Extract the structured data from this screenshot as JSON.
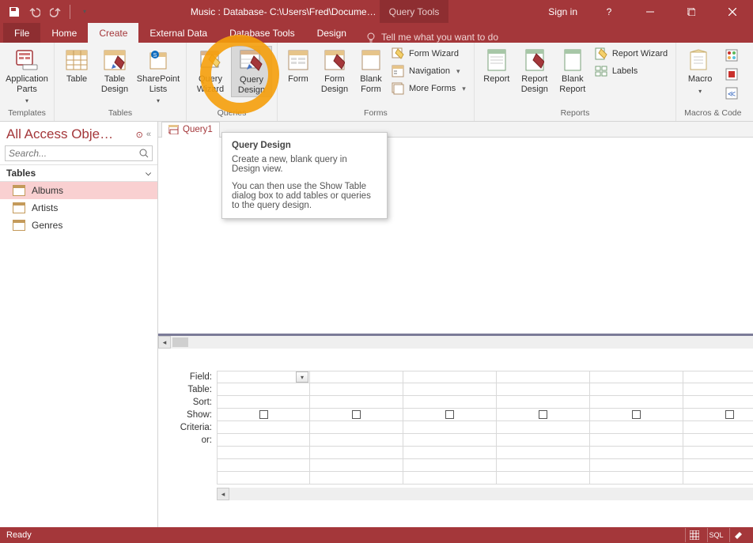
{
  "title": "Music : Database- C:\\Users\\Fred\\Docume…",
  "context_tab": "Query Tools",
  "signin": "Sign in",
  "tabs": {
    "file": "File",
    "home": "Home",
    "create": "Create",
    "external": "External Data",
    "dbtools": "Database Tools",
    "design": "Design",
    "tellme": "Tell me what you want to do"
  },
  "ribbon": {
    "templates": {
      "label": "Templates",
      "appparts": "Application\nParts"
    },
    "tables": {
      "label": "Tables",
      "table": "Table",
      "tabledesign": "Table\nDesign",
      "sharepoint": "SharePoint\nLists"
    },
    "queries": {
      "label": "Queries",
      "wizard": "Query\nWizard",
      "design": "Query\nDesign"
    },
    "forms": {
      "label": "Forms",
      "form": "Form",
      "formdesign": "Form\nDesign",
      "blank": "Blank\nForm",
      "formwiz": "Form Wizard",
      "nav": "Navigation",
      "more": "More Forms"
    },
    "reports": {
      "label": "Reports",
      "report": "Report",
      "rptdesign": "Report\nDesign",
      "blankrpt": "Blank\nReport",
      "rptwiz": "Report Wizard",
      "labels": "Labels"
    },
    "macros": {
      "label": "Macros & Code",
      "macro": "Macro"
    }
  },
  "tooltip": {
    "title": "Query Design",
    "p1": "Create a new, blank query in Design view.",
    "p2": "You can then use the Show Table dialog box to add tables or queries to the query design."
  },
  "sidebar": {
    "title": "All Access Obje…",
    "search_placeholder": "Search...",
    "category": "Tables",
    "items": [
      "Albums",
      "Artists",
      "Genres"
    ]
  },
  "doc_tab": "Query1",
  "grid_labels": [
    "Field:",
    "Table:",
    "Sort:",
    "Show:",
    "Criteria:",
    "or:"
  ],
  "statusbar": {
    "left": "Ready",
    "sql": "SQL"
  }
}
